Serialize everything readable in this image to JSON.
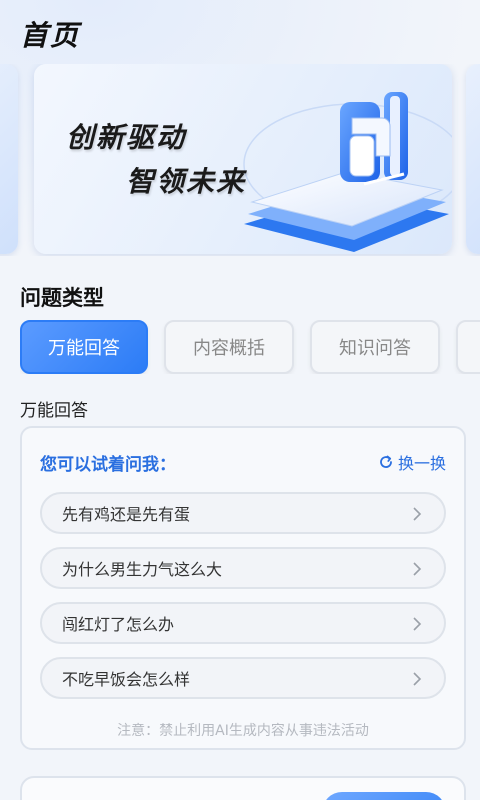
{
  "header": {
    "title": "首页"
  },
  "banner": {
    "line1": "创新驱动",
    "line2": "智领未来"
  },
  "section": {
    "title": "问题类型"
  },
  "tabs": [
    {
      "label": "万能回答",
      "active": true
    },
    {
      "label": "内容概括",
      "active": false
    },
    {
      "label": "知识问答",
      "active": false
    },
    {
      "label": "",
      "active": false
    }
  ],
  "current_type": "万能回答",
  "card": {
    "heading": "您可以试着问我：",
    "refresh_label": "换一换",
    "questions": [
      "先有鸡还是先有蛋",
      "为什么男生力气这么大",
      "闯红灯了怎么办",
      "不吃早饭会怎么样"
    ],
    "notice": "注意：禁止利用AI生成内容从事违法活动"
  },
  "colors": {
    "accent": "#2c7cf6",
    "link": "#2a6fe0",
    "background": "#f2f5fa"
  },
  "icons": {
    "refresh": "refresh-icon",
    "chevron": "chevron-right-icon"
  }
}
